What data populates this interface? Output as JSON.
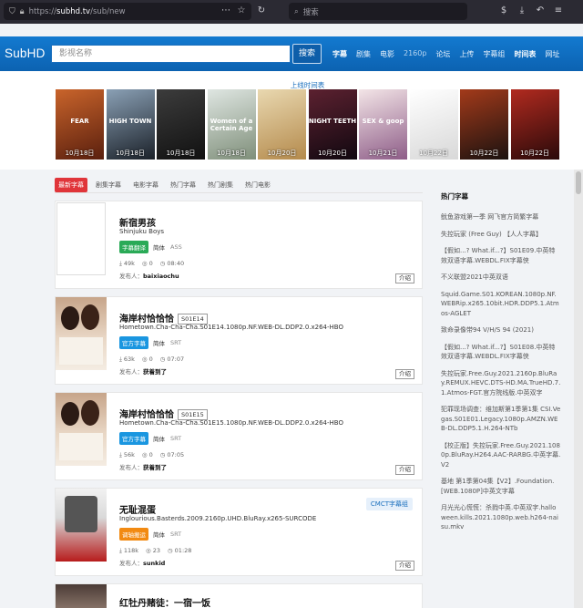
{
  "browser": {
    "url_scheme": "https://",
    "url_host": "subhd.tv",
    "url_path": "/sub/new",
    "search_placeholder": "搜索"
  },
  "header": {
    "logo": "SubHD",
    "search_placeholder": "影视名称",
    "search_button": "搜索",
    "nav": [
      {
        "label": "字幕",
        "active": true
      },
      {
        "label": "剧集"
      },
      {
        "label": "电影"
      },
      {
        "label": "2160p",
        "dim": true
      },
      {
        "label": "论坛"
      },
      {
        "label": "上传"
      },
      {
        "label": "字幕组"
      },
      {
        "label": "时间表",
        "active": true
      },
      {
        "label": "网址"
      }
    ]
  },
  "strip": {
    "title": "上线时间表",
    "posters": [
      {
        "date": "10月18日",
        "text": "FEAR",
        "c1": "#c9642b",
        "c2": "#5a1f0e"
      },
      {
        "date": "10月18日",
        "text": "HIGH TOWN",
        "c1": "#8aa0b5",
        "c2": "#1b2129"
      },
      {
        "date": "10月18日",
        "text": "",
        "c1": "#3c3c3c",
        "c2": "#111111"
      },
      {
        "date": "10月18日",
        "text": "Women of a Certain Age",
        "c1": "#dfe6e2",
        "c2": "#7f8f7a"
      },
      {
        "date": "10月20日",
        "text": "",
        "c1": "#e9d8b0",
        "c2": "#b48a4c"
      },
      {
        "date": "10月20日",
        "text": "NIGHT TEETH",
        "c1": "#5c2130",
        "c2": "#110810"
      },
      {
        "date": "10月21日",
        "text": "SEX & goop",
        "c1": "#f3e5e7",
        "c2": "#8e5d88"
      },
      {
        "date": "10月22日",
        "text": "",
        "c1": "#ffffff",
        "c2": "#d8d8d8"
      },
      {
        "date": "10月22日",
        "text": "",
        "c1": "#a33a1a",
        "c2": "#1b1210"
      },
      {
        "date": "10月22日",
        "text": "",
        "c1": "#b12a1f",
        "c2": "#2a0a0a"
      }
    ]
  },
  "tabs": [
    "最新字幕",
    "剧集字幕",
    "电影字幕",
    "热门字幕",
    "热门剧集",
    "热门电影"
  ],
  "cards": [
    {
      "title": "新宿男孩",
      "ep": "",
      "subtitle": "Shinjuku Boys",
      "badge": "字幕翻译",
      "badge_color": "green",
      "lang": "简体",
      "format": "ASS",
      "downloads": "49k",
      "comments": "0",
      "time": "08:40",
      "poster_label": "发布人：",
      "poster_name": "baixiaochu",
      "intro": "介绍",
      "group": "",
      "thumb": "blank"
    },
    {
      "title": "海岸村恰恰恰",
      "ep": "S01E14",
      "subtitle": "Hometown.Cha-Cha-Cha.S01E14.1080p.NF.WEB-DL.DDP2.0.x264-HBO",
      "badge": "官方字幕",
      "badge_color": "blue",
      "lang": "简体",
      "format": "SRT",
      "downloads": "63k",
      "comments": "0",
      "time": "07:07",
      "poster_label": "发布人：",
      "poster_name": "获着到了",
      "intro": "介绍",
      "group": "",
      "thumb": "couple"
    },
    {
      "title": "海岸村恰恰恰",
      "ep": "S01E15",
      "subtitle": "Hometown.Cha-Cha-Cha.S01E15.1080p.NF.WEB-DL.DDP2.0.x264-HBO",
      "badge": "官方字幕",
      "badge_color": "blue",
      "lang": "简体",
      "format": "SRT",
      "downloads": "56k",
      "comments": "0",
      "time": "07:05",
      "poster_label": "发布人：",
      "poster_name": "获着到了",
      "intro": "介绍",
      "group": "",
      "thumb": "couple"
    },
    {
      "title": "无耻混蛋",
      "ep": "",
      "subtitle": "Inglourious.Basterds.2009.2160p.UHD.BluRay.x265-SURCODE",
      "badge": "调轴搬运",
      "badge_color": "orange",
      "lang": "简体",
      "format": "SRT",
      "downloads": "118k",
      "comments": "23",
      "time": "01:28",
      "poster_label": "发布人：",
      "poster_name": "sunkid",
      "intro": "介绍",
      "group": "CMCT字幕组",
      "thumb": "basterds"
    },
    {
      "title": "红牡丹赌徒：一宿一饭",
      "ep": "",
      "subtitle": "",
      "badge": "",
      "badge_color": "",
      "lang": "",
      "format": "",
      "downloads": "",
      "comments": "",
      "time": "",
      "poster_label": "",
      "poster_name": "",
      "intro": "",
      "group": "",
      "thumb": "peony"
    }
  ],
  "sidebar": {
    "heading": "热门字幕",
    "items": [
      "鱿鱼游戏第一季 网飞官方简繁字幕",
      "失控玩家 (Free Guy) 【人人字幕】",
      "【假如...? What.if...?】S01E09.中英特效双语字幕.WEBDL.FIX字幕侠",
      "不义联盟2021中英双语",
      "Squid.Game.S01.KOREAN.1080p.NF.WEBRip.x265.10bit.HDR.DDP5.1.Atmos-AGLET",
      "致命录像带94 V/H/S 94 (2021)",
      "【假如...? What.if...?】S01E08.中英特效双语字幕.WEBDL.FIX字幕侠",
      "失控玩家.Free.Guy.2021.2160p.BluRay.REMUX.HEVC.DTS-HD.MA.TrueHD.7.1.Atmos-FGT.官方院线版.中英双字",
      "犯罪现场调查：维加斯第1季第1集 CSI.Vegas.S01E01.Legacy.1080p.AMZN.WEB-DL.DDP5.1.H.264-NTb",
      "【校正版】失控玩家.Free.Guy.2021.1080p.BluRay.H264.AAC-RARBG.中英字幕.V2",
      "基地 第1季第04集【V2】.Foundation.[WEB.1080P]中英文字幕",
      "月光光心慌慌：杀戮中英.中英双字.halloween.kills.2021.1080p.web.h264-naisu.mkv"
    ]
  },
  "stat_icons": {
    "download": "⤓",
    "comment": "◎",
    "time": "◷"
  }
}
